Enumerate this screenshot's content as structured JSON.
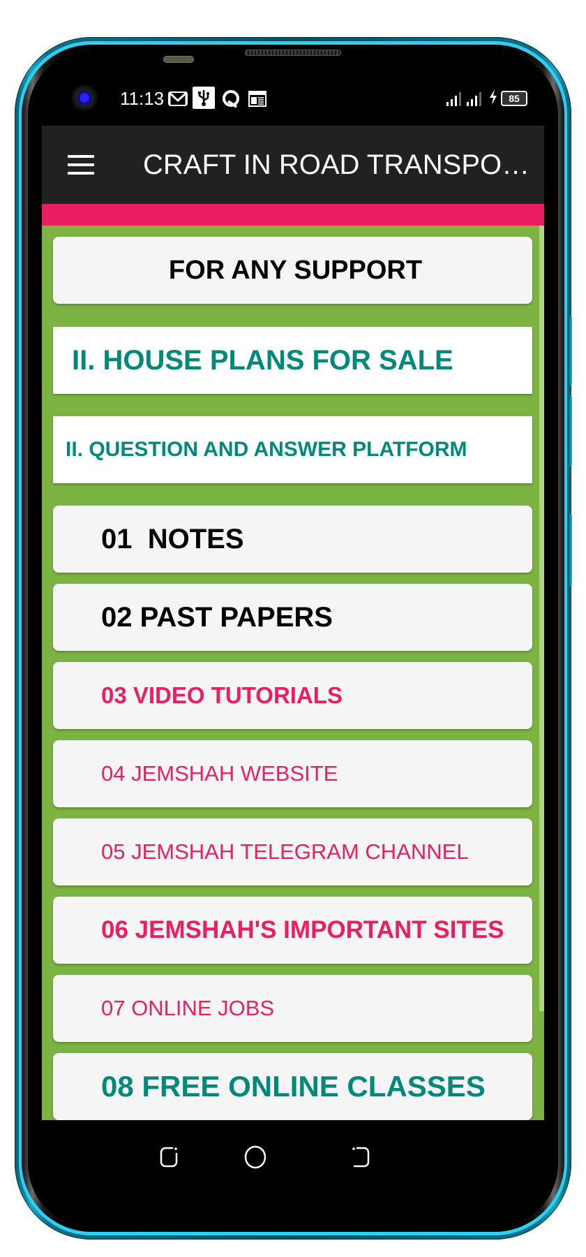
{
  "status_bar": {
    "time": "11:13",
    "notification_icons": [
      "gmail-icon",
      "usb-icon",
      "quick-app-icon",
      "calendar-icon"
    ],
    "battery_level": "85",
    "charging": true,
    "signal_icons": [
      "signal-sim1-icon",
      "signal-sim2-icon"
    ]
  },
  "toolbar": {
    "menu_icon": "hamburger-menu-icon",
    "title": "CRAFT IN ROAD TRANSPORT..."
  },
  "colors": {
    "toolbar_bg": "#212121",
    "accent": "#e91e63",
    "content_bg": "#7cb342",
    "teal": "#00897b",
    "pink": "#e91e63",
    "black": "#000000"
  },
  "menu": {
    "items": [
      {
        "label": "FOR ANY SUPPORT",
        "color": "#000000"
      },
      {
        "label": "II. HOUSE PLANS FOR SALE",
        "color": "#00897b"
      },
      {
        "label": "II. QUESTION AND ANSWER PLATFORM",
        "color": "#00897b"
      },
      {
        "label": "01  NOTES",
        "color": "#000000"
      },
      {
        "label": "02 PAST PAPERS",
        "color": "#000000"
      },
      {
        "label": "03 VIDEO TUTORIALS",
        "color": "#e91e63"
      },
      {
        "label": "04 JEMSHAH WEBSITE",
        "color": "#e91e63"
      },
      {
        "label": "05 JEMSHAH TELEGRAM CHANNEL",
        "color": "#e91e63"
      },
      {
        "label": "06 JEMSHAH'S IMPORTANT SITES",
        "color": "#e91e63"
      },
      {
        "label": "07 ONLINE JOBS",
        "color": "#e91e63"
      },
      {
        "label": "08 FREE ONLINE CLASSES",
        "color": "#00897b"
      }
    ]
  },
  "nav_bar": {
    "buttons": [
      "recent-apps",
      "home",
      "back"
    ]
  }
}
